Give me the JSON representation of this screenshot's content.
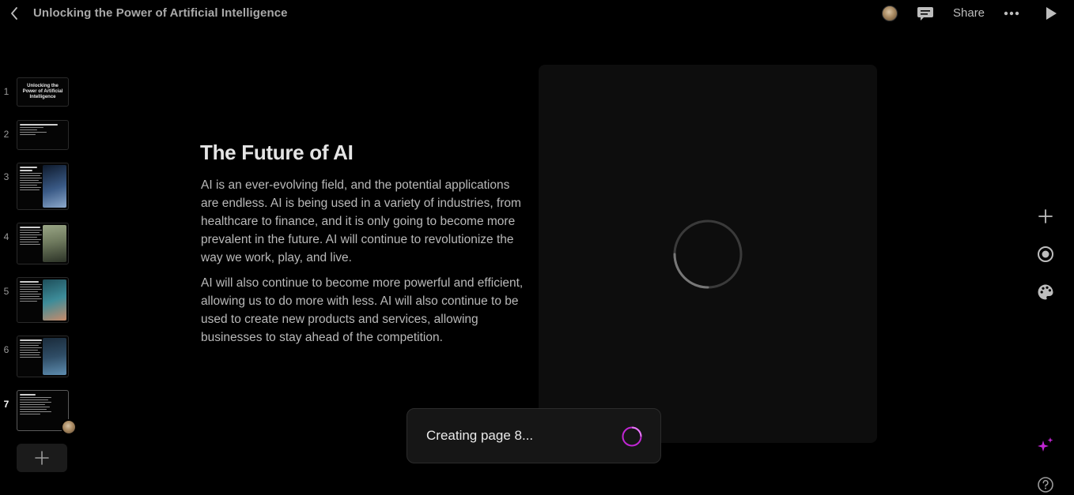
{
  "header": {
    "title": "Unlocking the Power of Artificial Intelligence",
    "share_label": "Share"
  },
  "thumbnails": [
    {
      "number": "1",
      "title": "Unlocking the Power of Artificial Intelligence",
      "image_color": ""
    },
    {
      "number": "2",
      "title": "",
      "image_color": ""
    },
    {
      "number": "3",
      "title": "",
      "image_color": "#3a5a86"
    },
    {
      "number": "4",
      "title": "",
      "image_color": "#6f7a5e"
    },
    {
      "number": "5",
      "title": "",
      "image_color": "#3d8c99"
    },
    {
      "number": "6",
      "title": "",
      "image_color": "#2f4d66"
    },
    {
      "number": "7",
      "title": "",
      "image_color": "",
      "active": true
    }
  ],
  "slide": {
    "heading": "The Future of AI",
    "paragraph1": "AI is an ever-evolving field, and the potential applications are endless. AI is being used in a variety of industries, from healthcare to finance, and it is only going to become more prevalent in the future. AI will continue to revolutionize the way we work, play, and live.",
    "paragraph2": "AI will also continue to become more powerful and efficient, allowing us to do more with less. AI will also continue to be used to create new products and services, allowing businesses to stay ahead of the competition."
  },
  "toast": {
    "message": "Creating page 8..."
  },
  "icons": {
    "back": "chevron-left-icon",
    "comment": "comment-icon",
    "more": "more-icon",
    "play": "play-icon",
    "add": "plus-icon",
    "record": "record-icon",
    "theme": "palette-icon",
    "ai": "sparkle-icon",
    "help": "help-icon"
  },
  "colors": {
    "accent": "#c026d3",
    "background": "#000000"
  }
}
